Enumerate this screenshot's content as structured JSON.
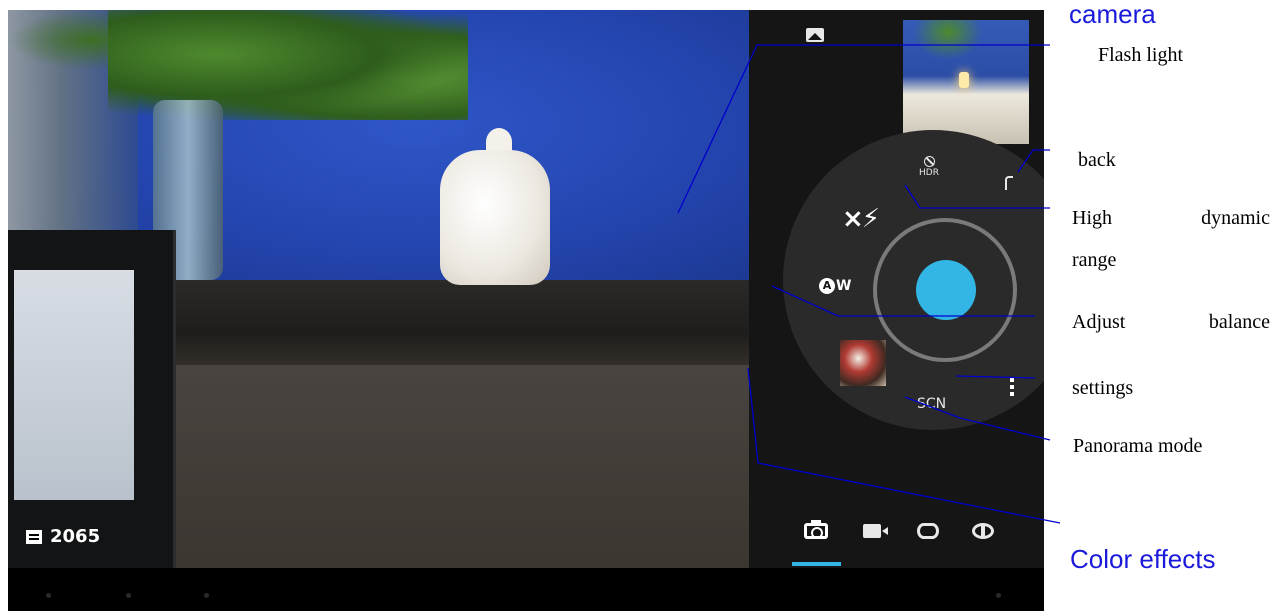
{
  "status": {
    "remaining_shots": "2065"
  },
  "annotations": {
    "title": "camera",
    "flash_light": "Flash light",
    "back": "back",
    "hdr_part1": "High",
    "hdr_part2": "dynamic",
    "hdr_part3": "range",
    "balance_part1": "Adjust",
    "balance_part2": "balance",
    "settings": "settings",
    "panorama": "Panorama mode",
    "color_effects": "Color effects"
  },
  "controls": {
    "hdr_label": "HDR",
    "awb_label": "W",
    "awb_badge": "A",
    "scene_label": "SCN",
    "flash_symbol": "×⚡"
  },
  "modes": [
    "camera",
    "video",
    "panorama",
    "photosphere"
  ],
  "colors": {
    "accent": "#33b5e5",
    "annotation_blue": "#1a1adb",
    "annotation_line": "#0000cc"
  },
  "icons": [
    "gallery-icon",
    "hdr-off-icon",
    "back-icon",
    "flash-off-icon",
    "awb-icon",
    "scene-icon",
    "overflow-menu-icon",
    "camera-mode-icon",
    "video-mode-icon",
    "panorama-mode-icon",
    "photosphere-mode-icon",
    "storage-icon"
  ]
}
